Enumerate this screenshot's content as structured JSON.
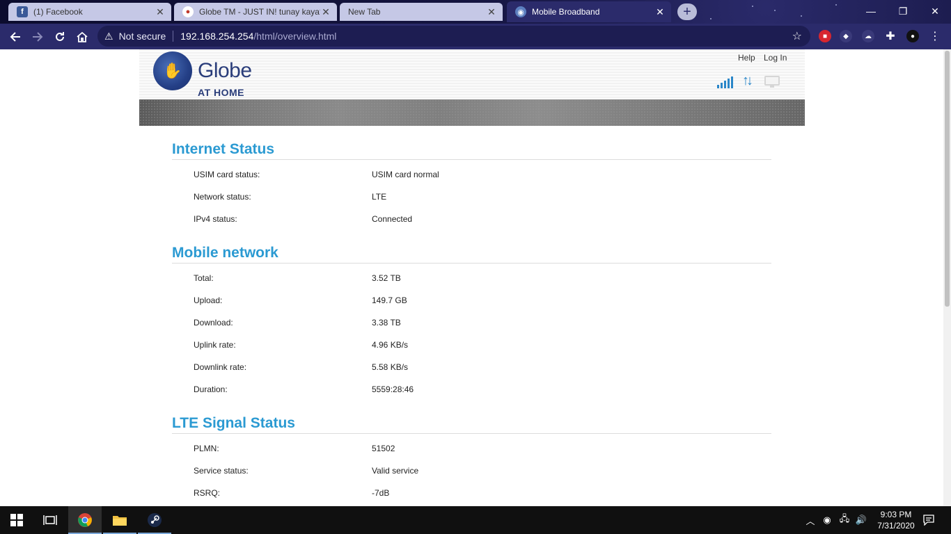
{
  "browser": {
    "tabs": [
      {
        "title": "(1) Facebook",
        "favicon": "facebook-icon",
        "active": false
      },
      {
        "title": "Globe TM - JUST IN! tunay kaya?",
        "favicon": "globe-tm-icon",
        "active": false
      },
      {
        "title": "New Tab",
        "favicon": "",
        "active": false
      },
      {
        "title": "Mobile Broadband",
        "favicon": "world-icon",
        "active": true
      }
    ],
    "security_label": "Not secure",
    "url_host": "192.168.254.254",
    "url_path": "/html/overview.html"
  },
  "router": {
    "brand": "Globe",
    "brand_sub": "AT HOME",
    "links": {
      "help": "Help",
      "login": "Log In"
    },
    "colors": {
      "accent": "#2b9ad2",
      "brand": "#2a3d7a",
      "status_icon": "#2a86c8"
    }
  },
  "sections": [
    {
      "title": "Internet Status",
      "rows": [
        {
          "label": "USIM card status:",
          "value": "USIM card normal"
        },
        {
          "label": "Network status:",
          "value": "LTE"
        },
        {
          "label": "IPv4 status:",
          "value": "Connected"
        }
      ]
    },
    {
      "title": "Mobile network",
      "rows": [
        {
          "label": "Total:",
          "value": "3.52 TB"
        },
        {
          "label": "Upload:",
          "value": "149.7 GB"
        },
        {
          "label": "Download:",
          "value": "3.38 TB"
        },
        {
          "label": "Uplink rate:",
          "value": "4.96 KB/s"
        },
        {
          "label": "Downlink rate:",
          "value": "5.58 KB/s"
        },
        {
          "label": "Duration:",
          "value": "5559:28:46"
        }
      ]
    },
    {
      "title": "LTE Signal Status",
      "rows": [
        {
          "label": "PLMN:",
          "value": "51502"
        },
        {
          "label": "Service status:",
          "value": "Valid service"
        },
        {
          "label": "RSRQ:",
          "value": "-7dB"
        }
      ]
    }
  ],
  "taskbar": {
    "time": "9:03 PM",
    "date": "7/31/2020"
  }
}
